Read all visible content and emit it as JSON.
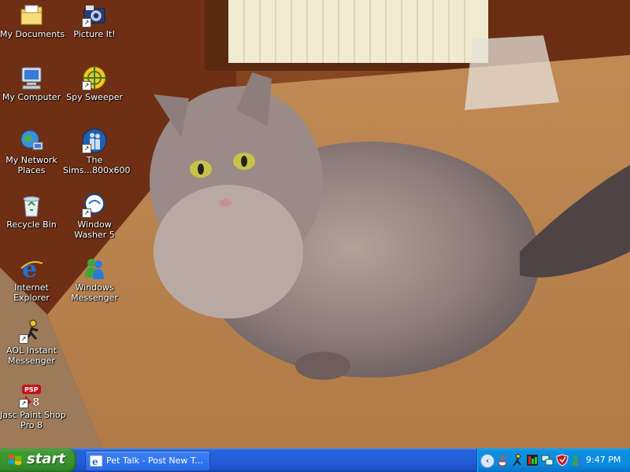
{
  "desktop": {
    "icons": [
      {
        "label_1": "My Documents",
        "label_2": "",
        "icon": "folder-documents-icon",
        "shortcut": false
      },
      {
        "label_1": "Picture It!",
        "label_2": "",
        "icon": "camera-icon",
        "shortcut": true
      },
      {
        "label_1": "My Computer",
        "label_2": "",
        "icon": "computer-icon",
        "shortcut": false
      },
      {
        "label_1": "Spy Sweeper",
        "label_2": "",
        "icon": "spy-sweeper-icon",
        "shortcut": true
      },
      {
        "label_1": "My Network",
        "label_2": "Places",
        "icon": "network-places-icon",
        "shortcut": false
      },
      {
        "label_1": "The",
        "label_2": "Sims...800x600",
        "icon": "sims-icon",
        "shortcut": true
      },
      {
        "label_1": "Recycle Bin",
        "label_2": "",
        "icon": "recycle-bin-icon",
        "shortcut": false
      },
      {
        "label_1": "Window",
        "label_2": "Washer 5",
        "icon": "window-washer-icon",
        "shortcut": true
      },
      {
        "label_1": "Internet",
        "label_2": "Explorer",
        "icon": "internet-explorer-icon",
        "shortcut": false
      },
      {
        "label_1": "Windows",
        "label_2": "Messenger",
        "icon": "windows-messenger-icon",
        "shortcut": false
      },
      {
        "label_1": "AOL Instant",
        "label_2": "Messenger",
        "icon": "aim-icon",
        "shortcut": true
      },
      {
        "label_1": "Jasc Paint Shop",
        "label_2": "Pro 8",
        "icon": "paint-shop-pro-icon",
        "shortcut": true
      }
    ]
  },
  "taskbar": {
    "start_label": "start",
    "task_button_label": "Pet Talk - Post New T...",
    "task_button_icon": "internet-explorer-icon",
    "tray_icons": [
      "java-icon",
      "aim-icon",
      "meter-icon",
      "network-icon",
      "security-shield-icon",
      "messenger-icon"
    ],
    "clock": "9:47 PM"
  },
  "colors": {
    "taskbar_blue": "#245edb",
    "start_green": "#3c9a33",
    "tray_blue": "#0b8bdd"
  }
}
